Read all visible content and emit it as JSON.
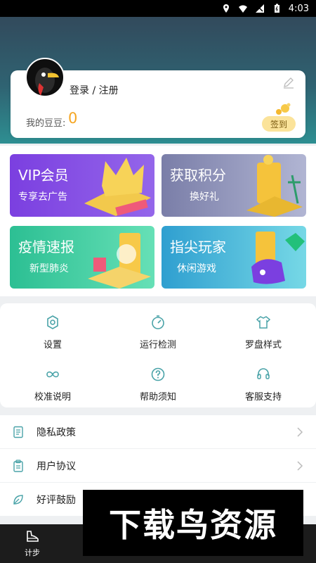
{
  "status_bar": {
    "time": "4:03"
  },
  "profile": {
    "login_label": "登录 / 注册",
    "beans_label": "我的豆豆:",
    "beans_value": "0",
    "signin_label": "签到"
  },
  "promos": {
    "vip": {
      "title": "VIP会员",
      "subtitle": "专享去广告"
    },
    "points": {
      "title": "获取积分",
      "subtitle": "换好礼"
    },
    "epidemic": {
      "title": "疫情速报",
      "subtitle": "新型肺炎"
    },
    "game": {
      "title": "指尖玩家",
      "subtitle": "休闲游戏"
    }
  },
  "grid": {
    "items": [
      {
        "label": "设置",
        "icon": "settings-icon"
      },
      {
        "label": "运行检测",
        "icon": "compass-icon"
      },
      {
        "label": "罗盘样式",
        "icon": "shirt-icon"
      },
      {
        "label": "校准说明",
        "icon": "infinity-icon"
      },
      {
        "label": "帮助须知",
        "icon": "help-icon"
      },
      {
        "label": "客服支持",
        "icon": "headset-icon"
      }
    ]
  },
  "list": {
    "items": [
      {
        "label": "隐私政策",
        "icon": "document-icon"
      },
      {
        "label": "用户协议",
        "icon": "clipboard-icon"
      },
      {
        "label": "好评鼓励",
        "icon": "leaf-icon"
      }
    ]
  },
  "bottom_nav": {
    "step_label": "计步"
  },
  "watermark": {
    "text": "下载鸟资源"
  },
  "colors": {
    "accent": "#f5a623",
    "header_top": "#324a5c",
    "header_bottom": "#2e8f92"
  }
}
